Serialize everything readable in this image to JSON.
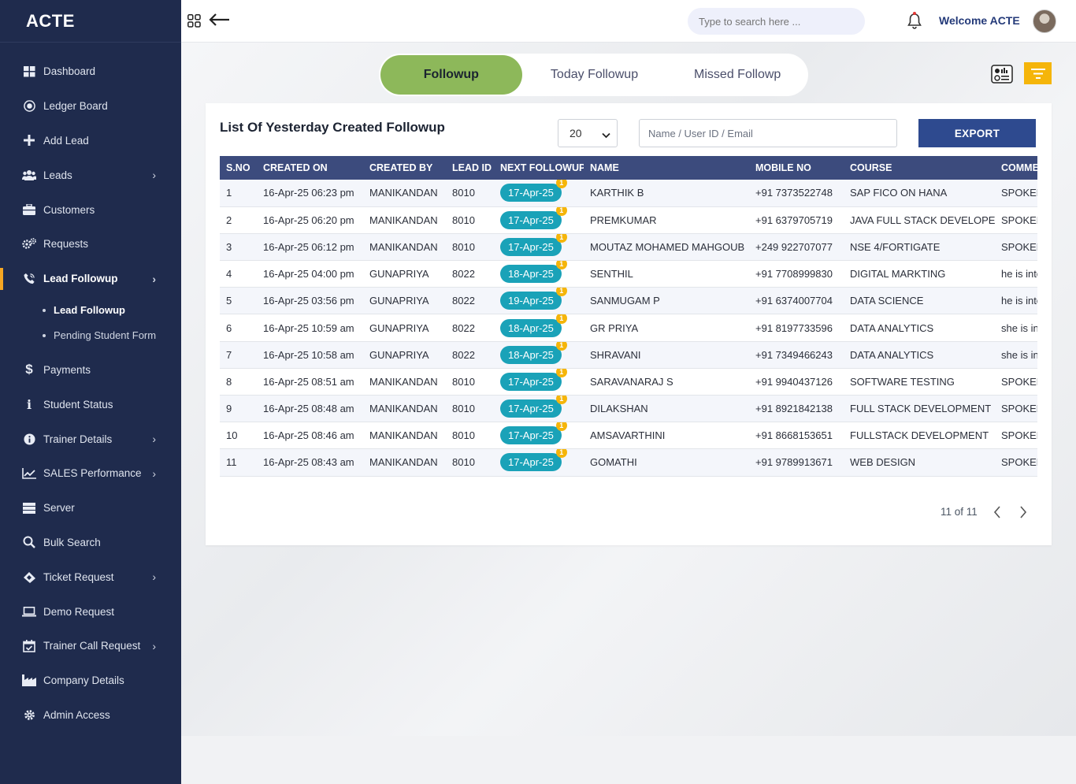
{
  "brand": "ACTE",
  "sidebar": {
    "items": [
      {
        "label": "Dashboard",
        "icon": "grid-icon"
      },
      {
        "label": "Ledger Board",
        "icon": "target-icon"
      },
      {
        "label": "Add Lead",
        "icon": "plus-icon"
      },
      {
        "label": "Leads",
        "icon": "users-icon",
        "has_children": true
      },
      {
        "label": "Customers",
        "icon": "briefcase-icon"
      },
      {
        "label": "Requests",
        "icon": "gears-icon"
      },
      {
        "label": "Lead Followup",
        "icon": "phone-icon",
        "has_children": true,
        "active": true
      },
      {
        "label": "Payments",
        "icon": "dollar-icon"
      },
      {
        "label": "Student Status",
        "icon": "info-icon"
      },
      {
        "label": "Trainer Details",
        "icon": "info-circle-icon",
        "has_children": true
      },
      {
        "label": "SALES Performance",
        "icon": "chart-line-icon",
        "has_children": true
      },
      {
        "label": "Server",
        "icon": "server-icon"
      },
      {
        "label": "Bulk Search",
        "icon": "search-icon"
      },
      {
        "label": "Ticket Request",
        "icon": "ticket-icon",
        "has_children": true
      },
      {
        "label": "Demo Request",
        "icon": "laptop-icon"
      },
      {
        "label": "Trainer Call Request",
        "icon": "calendar-check-icon",
        "has_children": true
      },
      {
        "label": "Company Details",
        "icon": "industry-icon"
      },
      {
        "label": "Admin Access",
        "icon": "gear-icon"
      }
    ],
    "sub_items": [
      {
        "label": "Lead Followup",
        "active": true
      },
      {
        "label": "Pending Student Form",
        "active": false
      }
    ]
  },
  "header": {
    "search_placeholder": "Type to search here ...",
    "welcome": "Welcome ACTE"
  },
  "tabs": [
    {
      "label": "Followup",
      "active": true
    },
    {
      "label": "Today Followup",
      "active": false
    },
    {
      "label": "Missed Followp",
      "active": false
    }
  ],
  "card": {
    "title": "List Of Yesterday Created Followup",
    "page_size": "20",
    "filter_placeholder": "Name / User ID / Email",
    "export_label": "EXPORT"
  },
  "table": {
    "columns": [
      "S.NO",
      "CREATED ON",
      "CREATED BY",
      "LEAD ID",
      "NEXT FOLLOWUP",
      "NAME",
      "MOBILE NO",
      "COURSE",
      "COMMENTS"
    ],
    "rows": [
      {
        "sno": "1",
        "created_on": "16-Apr-25 06:23 pm",
        "created_by": "MANIKANDAN",
        "lead_id": "8010",
        "next": "17-Apr-25",
        "count": "1",
        "name": "KARTHIK B",
        "mobile": "+91 7373522748",
        "course": "SAP FICO ON HANA",
        "comment": "SPOKEN"
      },
      {
        "sno": "2",
        "created_on": "16-Apr-25 06:20 pm",
        "created_by": "MANIKANDAN",
        "lead_id": "8010",
        "next": "17-Apr-25",
        "count": "1",
        "name": "PREMKUMAR",
        "mobile": "+91 6379705719",
        "course": "JAVA FULL STACK DEVELOPER",
        "comment": "SPOKEN"
      },
      {
        "sno": "3",
        "created_on": "16-Apr-25 06:12 pm",
        "created_by": "MANIKANDAN",
        "lead_id": "8010",
        "next": "17-Apr-25",
        "count": "1",
        "name": "MOUTAZ MOHAMED MAHGOUB",
        "mobile": "+249 922707077",
        "course": "NSE 4/FORTIGATE",
        "comment": "SPOKEN"
      },
      {
        "sno": "4",
        "created_on": "16-Apr-25 04:00 pm",
        "created_by": "GUNAPRIYA",
        "lead_id": "8022",
        "next": "18-Apr-25",
        "count": "1",
        "name": "SENTHIL",
        "mobile": "+91 7708999830",
        "course": "DIGITAL MARKTING",
        "comment": "he is interested"
      },
      {
        "sno": "5",
        "created_on": "16-Apr-25 03:56 pm",
        "created_by": "GUNAPRIYA",
        "lead_id": "8022",
        "next": "19-Apr-25",
        "count": "1",
        "name": "SANMUGAM P",
        "mobile": "+91 6374007704",
        "course": "DATA SCIENCE",
        "comment": "he is interested"
      },
      {
        "sno": "6",
        "created_on": "16-Apr-25 10:59 am",
        "created_by": "GUNAPRIYA",
        "lead_id": "8022",
        "next": "18-Apr-25",
        "count": "1",
        "name": "GR PRIYA",
        "mobile": "+91 8197733596",
        "course": "DATA ANALYTICS",
        "comment": "she is interested"
      },
      {
        "sno": "7",
        "created_on": "16-Apr-25 10:58 am",
        "created_by": "GUNAPRIYA",
        "lead_id": "8022",
        "next": "18-Apr-25",
        "count": "1",
        "name": "SHRAVANI",
        "mobile": "+91 7349466243",
        "course": "DATA ANALYTICS",
        "comment": "she is interested"
      },
      {
        "sno": "8",
        "created_on": "16-Apr-25 08:51 am",
        "created_by": "MANIKANDAN",
        "lead_id": "8010",
        "next": "17-Apr-25",
        "count": "1",
        "name": "SARAVANARAJ S",
        "mobile": "+91 9940437126",
        "course": "SOFTWARE TESTING",
        "comment": "SPOKEN"
      },
      {
        "sno": "9",
        "created_on": "16-Apr-25 08:48 am",
        "created_by": "MANIKANDAN",
        "lead_id": "8010",
        "next": "17-Apr-25",
        "count": "1",
        "name": "DILAKSHAN",
        "mobile": "+91 8921842138",
        "course": "FULL STACK DEVELOPMENT",
        "comment": "SPOKEN"
      },
      {
        "sno": "10",
        "created_on": "16-Apr-25 08:46 am",
        "created_by": "MANIKANDAN",
        "lead_id": "8010",
        "next": "17-Apr-25",
        "count": "1",
        "name": "AMSAVARTHINI",
        "mobile": "+91 8668153651",
        "course": "FULLSTACK DEVELOPMENT",
        "comment": "SPOKEN"
      },
      {
        "sno": "11",
        "created_on": "16-Apr-25 08:43 am",
        "created_by": "MANIKANDAN",
        "lead_id": "8010",
        "next": "17-Apr-25",
        "count": "1",
        "name": "GOMATHI",
        "mobile": "+91 9789913671",
        "course": "WEB DESIGN",
        "comment": "SPOKEN"
      }
    ]
  },
  "pagination": {
    "label": "11 of 11"
  },
  "colors": {
    "sidebar": "#1f2b4d",
    "active_tab": "#8db85a",
    "table_header": "#3c4b7d",
    "badge": "#1aa2b8",
    "accent": "#f5b50a",
    "export": "#2e4a8f"
  }
}
